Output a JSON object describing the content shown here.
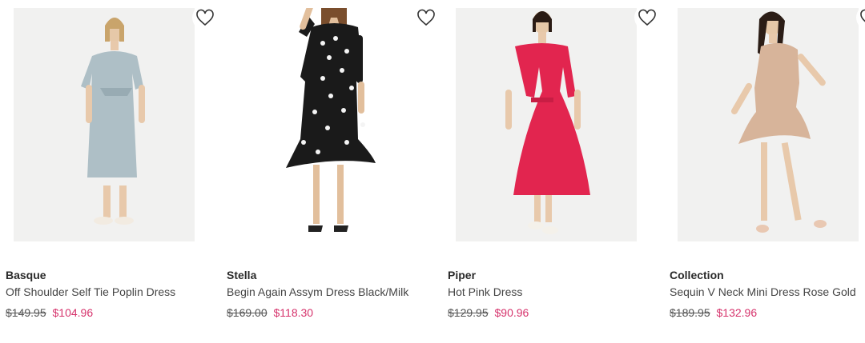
{
  "products": [
    {
      "brand": "Basque",
      "name": "Off Shoulder Self Tie Poplin Dress",
      "was_price": "$149.95",
      "sale_price": "$104.96",
      "image_bg": "#f1f1f0",
      "dress_color": "#aebfc6",
      "icon": "heart-outline-icon"
    },
    {
      "brand": "Stella",
      "name": "Begin Again Assym Dress Black/Milk",
      "was_price": "$169.00",
      "sale_price": "$118.30",
      "image_bg": "#ffffff",
      "dress_color": "#1a1a1a",
      "icon": "heart-outline-icon"
    },
    {
      "brand": "Piper",
      "name": "Hot Pink Dress",
      "was_price": "$129.95",
      "sale_price": "$90.96",
      "image_bg": "#f1f1f0",
      "dress_color": "#e2254f",
      "icon": "heart-outline-icon"
    },
    {
      "brand": "Collection",
      "name": "Sequin V Neck Mini Dress Rose Gold",
      "was_price": "$189.95",
      "sale_price": "$132.96",
      "image_bg": "#f1f1f0",
      "dress_color": "#d7b49a",
      "icon": "heart-outline-icon"
    }
  ],
  "colors": {
    "sale": "#d6336c",
    "text": "#333333"
  }
}
